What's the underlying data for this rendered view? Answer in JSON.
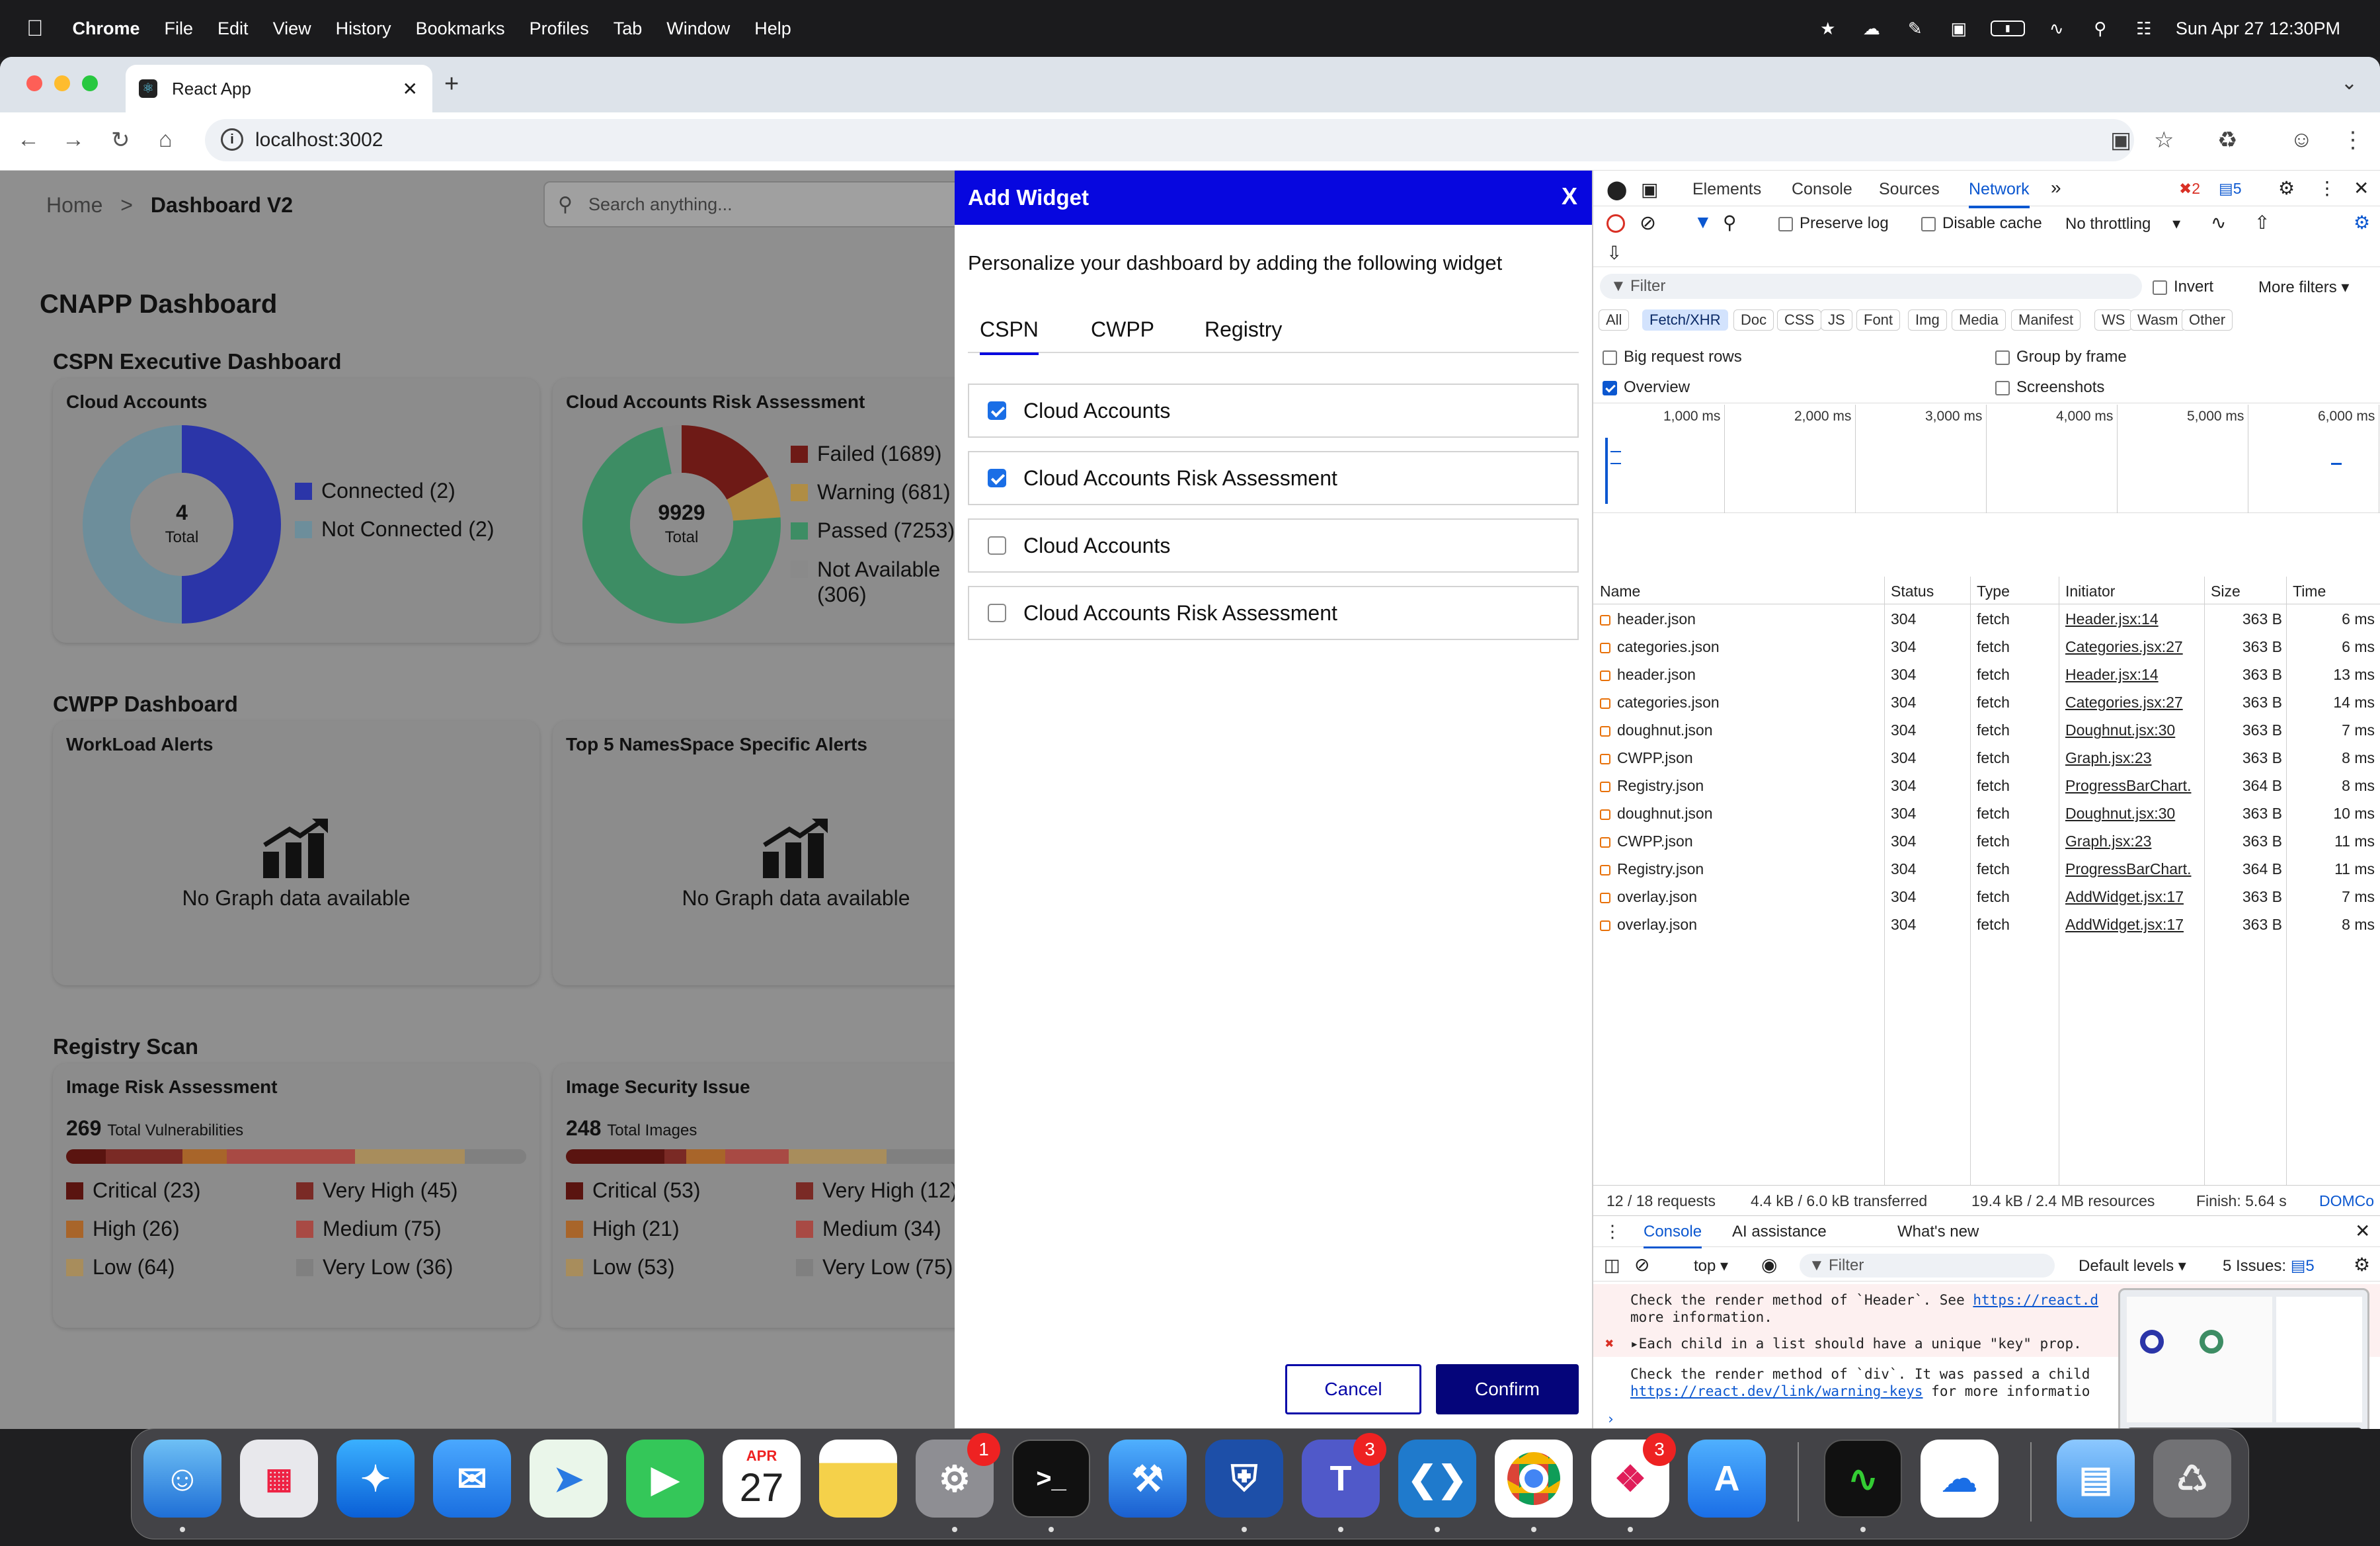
{
  "menubar": {
    "app": "Chrome",
    "items": [
      "File",
      "Edit",
      "View",
      "History",
      "Bookmarks",
      "Profiles",
      "Tab",
      "Window",
      "Help"
    ],
    "datetime": "Sun Apr 27  12:30PM"
  },
  "browser": {
    "tab_title": "React App",
    "url": "localhost:3002"
  },
  "app": {
    "breadcrumb_home": "Home",
    "breadcrumb_sep": ">",
    "breadcrumb_current": "Dashboard V2",
    "search_placeholder": "Search anything...",
    "dashboard_title": "CNAPP Dashboard",
    "sections": {
      "cspn": "CSPN Executive Dashboard",
      "cwpp": "CWPP Dashboard",
      "registry": "Registry Scan"
    },
    "cloud_accounts": {
      "title": "Cloud Accounts",
      "center_value": "4",
      "center_label": "Total",
      "legend": [
        {
          "label": "Connected (2)",
          "color": "#2b35a8",
          "value": 2
        },
        {
          "label": "Not Connected (2)",
          "color": "#6d8e9b",
          "value": 2
        }
      ]
    },
    "risk_assessment": {
      "title": "Cloud Accounts Risk Assessment",
      "center_value": "9929",
      "center_label": "Total",
      "legend": [
        {
          "label": "Failed (1689)",
          "color": "#6e1a16",
          "value": 1689
        },
        {
          "label": "Warning (681)",
          "color": "#b08d44",
          "value": 681
        },
        {
          "label": "Passed (7253)",
          "color": "#3d8d64",
          "value": 7253
        },
        {
          "label": "Not Available",
          "label2": "(306)",
          "color": "#8a8a8a",
          "value": 306
        }
      ]
    },
    "workload": {
      "title": "WorkLoad Alerts",
      "empty": "No Graph data available"
    },
    "namespace": {
      "title": "Top 5 NamesSpace Specific Alerts",
      "empty": "No Graph data available"
    },
    "image_risk": {
      "title": "Image Risk Assessment",
      "count": "269",
      "count_label": "Total Vulnerabilities",
      "items": [
        {
          "label": "Critical (23)",
          "color": "#5a1410",
          "value": 23
        },
        {
          "label": "Very High (45)",
          "color": "#7a2a25",
          "value": 45
        },
        {
          "label": "High (26)",
          "color": "#a8652a",
          "value": 26
        },
        {
          "label": "Medium (75)",
          "color": "#a84a44",
          "value": 75
        },
        {
          "label": "Low (64)",
          "color": "#a88d5c",
          "value": 64
        },
        {
          "label": "Very Low (36)",
          "color": "#808080",
          "value": 36
        }
      ]
    },
    "image_security": {
      "title": "Image Security Issue",
      "count": "248",
      "count_label": "Total Images",
      "items": [
        {
          "label": "Critical (53)",
          "color": "#5a1410",
          "value": 53
        },
        {
          "label": "Very High (12)",
          "color": "#7a2a25",
          "value": 12
        },
        {
          "label": "High (21)",
          "color": "#a8652a",
          "value": 21
        },
        {
          "label": "Medium (34)",
          "color": "#a84a44",
          "value": 34
        },
        {
          "label": "Low (53)",
          "color": "#a88d5c",
          "value": 53
        },
        {
          "label": "Very Low (75)",
          "color": "#808080",
          "value": 75
        }
      ]
    }
  },
  "modal": {
    "title": "Add Widget",
    "close": "X",
    "description": "Personalize your dashboard by adding the following widget",
    "tabs": [
      "CSPN",
      "CWPP",
      "Registry"
    ],
    "widgets": [
      {
        "label": "Cloud Accounts",
        "checked": true
      },
      {
        "label": "Cloud Accounts Risk Assessment",
        "checked": true
      },
      {
        "label": "Cloud Accounts",
        "checked": false
      },
      {
        "label": "Cloud Accounts Risk Assessment",
        "checked": false
      }
    ],
    "cancel": "Cancel",
    "confirm": "Confirm"
  },
  "devtools": {
    "tabs": [
      "Elements",
      "Console",
      "Sources",
      "Network"
    ],
    "errors": "2",
    "warnings": "5",
    "preserve_log": "Preserve log",
    "disable_cache": "Disable cache",
    "throttling": "No throttling",
    "filter_placeholder": "Filter",
    "invert": "Invert",
    "more_filters": "More filters",
    "type_filters": [
      "All",
      "Fetch/XHR",
      "Doc",
      "CSS",
      "JS",
      "Font",
      "Img",
      "Media",
      "Manifest",
      "WS",
      "Wasm",
      "Other"
    ],
    "big_rows": "Big request rows",
    "group_by_frame": "Group by frame",
    "overview": "Overview",
    "screenshots": "Screenshots",
    "timeline_ticks": [
      "1,000 ms",
      "2,000 ms",
      "3,000 ms",
      "4,000 ms",
      "5,000 ms",
      "6,000 ms"
    ],
    "columns": [
      "Name",
      "Status",
      "Type",
      "Initiator",
      "Size",
      "Time"
    ],
    "rows": [
      [
        "header.json",
        "304",
        "fetch",
        "Header.jsx:14",
        "363 B",
        "6 ms"
      ],
      [
        "categories.json",
        "304",
        "fetch",
        "Categories.jsx:27",
        "363 B",
        "6 ms"
      ],
      [
        "header.json",
        "304",
        "fetch",
        "Header.jsx:14",
        "363 B",
        "13 ms"
      ],
      [
        "categories.json",
        "304",
        "fetch",
        "Categories.jsx:27",
        "363 B",
        "14 ms"
      ],
      [
        "doughnut.json",
        "304",
        "fetch",
        "Doughnut.jsx:30",
        "363 B",
        "7 ms"
      ],
      [
        "CWPP.json",
        "304",
        "fetch",
        "Graph.jsx:23",
        "363 B",
        "8 ms"
      ],
      [
        "Registry.json",
        "304",
        "fetch",
        "ProgressBarChart.",
        "364 B",
        "8 ms"
      ],
      [
        "doughnut.json",
        "304",
        "fetch",
        "Doughnut.jsx:30",
        "363 B",
        "10 ms"
      ],
      [
        "CWPP.json",
        "304",
        "fetch",
        "Graph.jsx:23",
        "363 B",
        "11 ms"
      ],
      [
        "Registry.json",
        "304",
        "fetch",
        "ProgressBarChart.",
        "364 B",
        "11 ms"
      ],
      [
        "overlay.json",
        "304",
        "fetch",
        "AddWidget.jsx:17",
        "363 B",
        "7 ms"
      ],
      [
        "overlay.json",
        "304",
        "fetch",
        "AddWidget.jsx:17",
        "363 B",
        "8 ms"
      ]
    ],
    "summary": {
      "requests": "12 / 18 requests",
      "transferred": "4.4 kB / 6.0 kB transferred",
      "resources": "19.4 kB / 2.4 MB resources",
      "finish": "Finish: 5.64 s",
      "domc": "DOMCo"
    },
    "drawer_tabs": [
      "Console",
      "AI assistance",
      "What's new"
    ],
    "console_context": "top",
    "console_filter": "Filter",
    "levels": "Default levels",
    "issues": "5 Issues:",
    "issues_count": "5",
    "console_lines": {
      "l1": "Check the render method of `Header`. See",
      "l1_link": "https://react.d",
      "l2": "more information.",
      "l3": "Each child in a list should have a unique \"key\" prop.",
      "l4": "Check the render method of `div`. It was passed a child",
      "l5_link": "https://react.dev/link/warning-keys",
      "l5_tail": "for more informatio"
    }
  },
  "dock": {
    "calendar_month": "APR",
    "calendar_day": "27",
    "badges": {
      "settings": "1",
      "teams": "3",
      "slack": "3"
    }
  }
}
